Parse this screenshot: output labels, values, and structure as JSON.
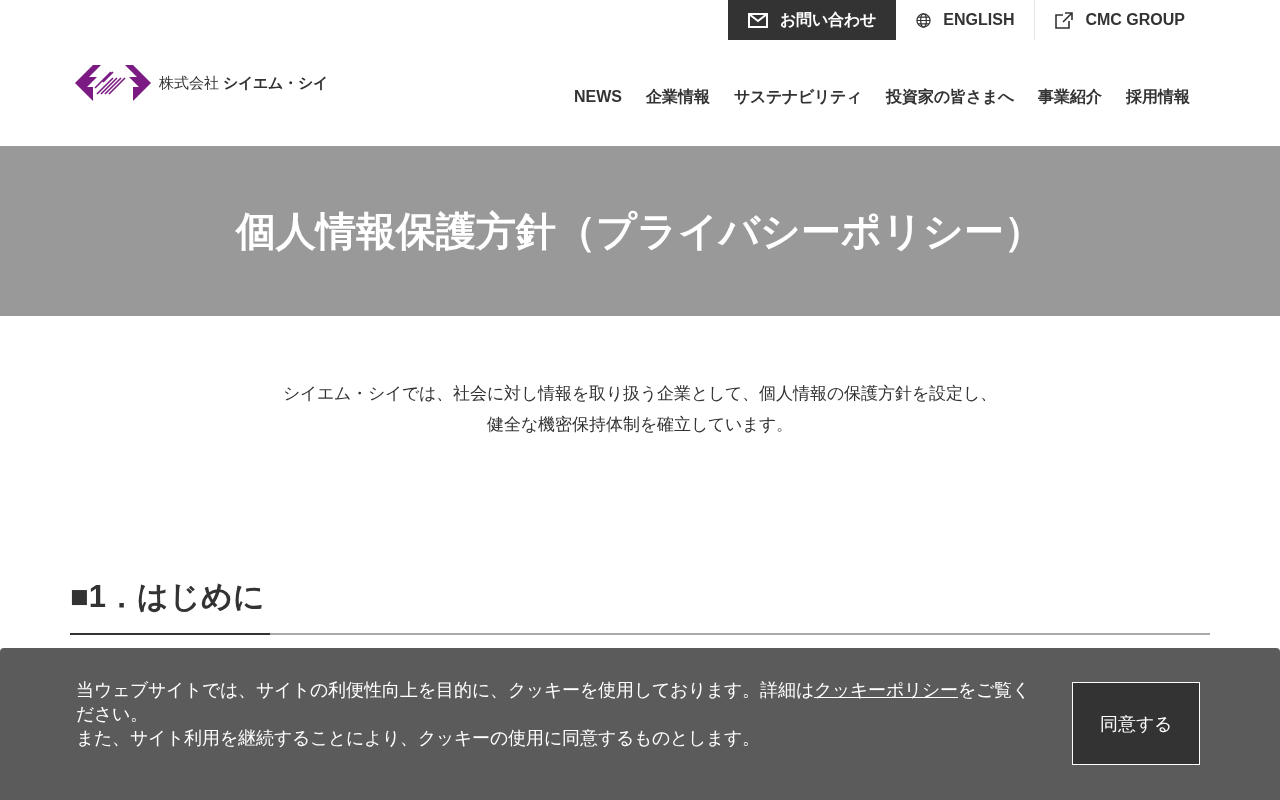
{
  "top_links": [
    {
      "kind": "contact",
      "label": "お問い合わせ"
    },
    {
      "kind": "language",
      "label": "ENGLISH"
    },
    {
      "kind": "external",
      "label": "CMC GROUP"
    }
  ],
  "logo": {
    "text": "株式会社 **シイエム・シイ**"
  },
  "nav": [
    {
      "label": "NEWS"
    },
    {
      "label": "企業情報"
    },
    {
      "label": "サステナビリティ"
    },
    {
      "label": "投資家の皆さまへ"
    },
    {
      "label": "事業紹介"
    },
    {
      "label": "採用情報"
    }
  ],
  "hero": {
    "title": "個人情報保護方針（プライバシーポリシー）"
  },
  "intro": [
    "シイエム・シイでは、社会に対し情報を取り扱う企業として、個人情報の保護方針を設定し、",
    "健全な機密保持体制を確立しています。"
  ],
  "section": {
    "heading": "■1．はじめに"
  },
  "cookie_banner": {
    "text_before": "当ウェブサイトでは、サイトの利便性向上を目的に、クッキーを使用しております。詳細は",
    "link": "クッキーポリシー",
    "text_after": "をご覧ください。",
    "text_2": "また、サイト利用を継続することにより、クッキーの使用に同意するものとします。",
    "button": "同意する"
  }
}
